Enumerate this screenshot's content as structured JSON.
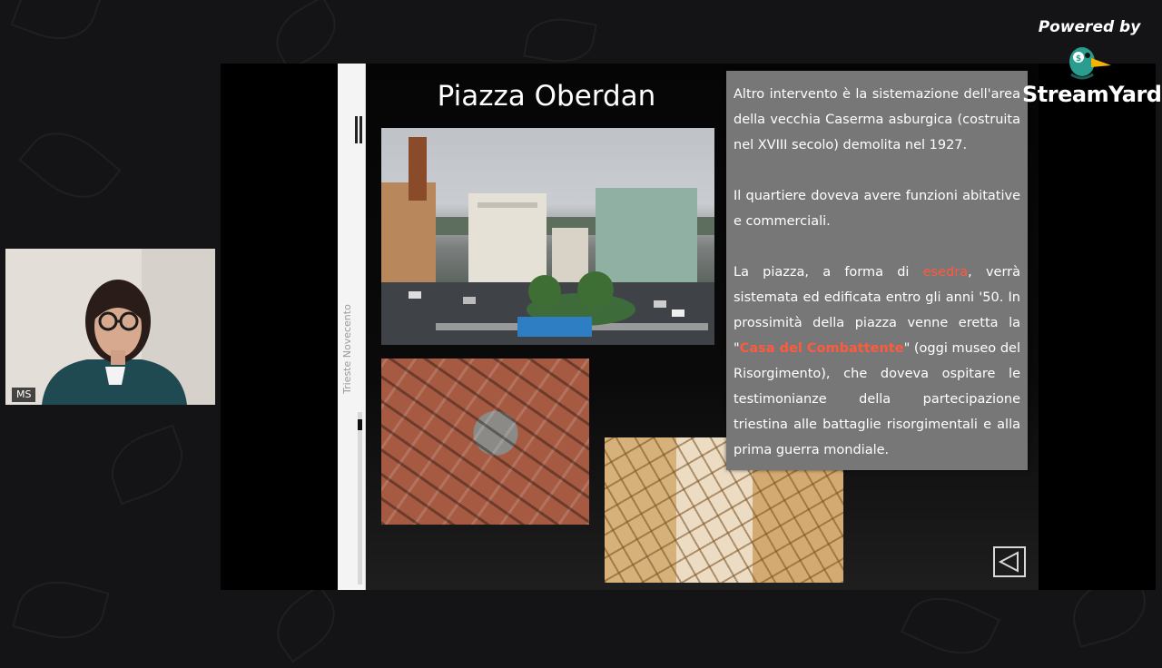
{
  "branding": {
    "powered_by": "Powered by",
    "logo_text": "StreamYard"
  },
  "participant": {
    "initials": "MS"
  },
  "slide": {
    "sidebar_title": "Trieste Novecento",
    "title": "Piazza Oberdan",
    "text": {
      "p1": "Altro intervento è la sistemazione dell'area della vecchia Caserma asburgica (costruita nel XVIII secolo) demolita nel 1927.",
      "p2": "Il quartiere doveva avere funzioni abitative e commerciali.",
      "p3_before": "La piazza, a forma di ",
      "p3_highlight": "esedra",
      "p3_after": ", verrà sistemata ed edificata entro gli anni '50. In prossimità della piazza venne eretta la \"",
      "p3_highlight2": "Casa del Combattente",
      "p3_end": "\" (oggi museo del Risorgimento), che doveva ospitare le testimonianze della partecipazione triestina alle battaglie risorgimentali e alla prima guerra mondiale."
    }
  },
  "colors": {
    "highlight": "#ff5a3c",
    "textbox_bg": "#777778"
  }
}
